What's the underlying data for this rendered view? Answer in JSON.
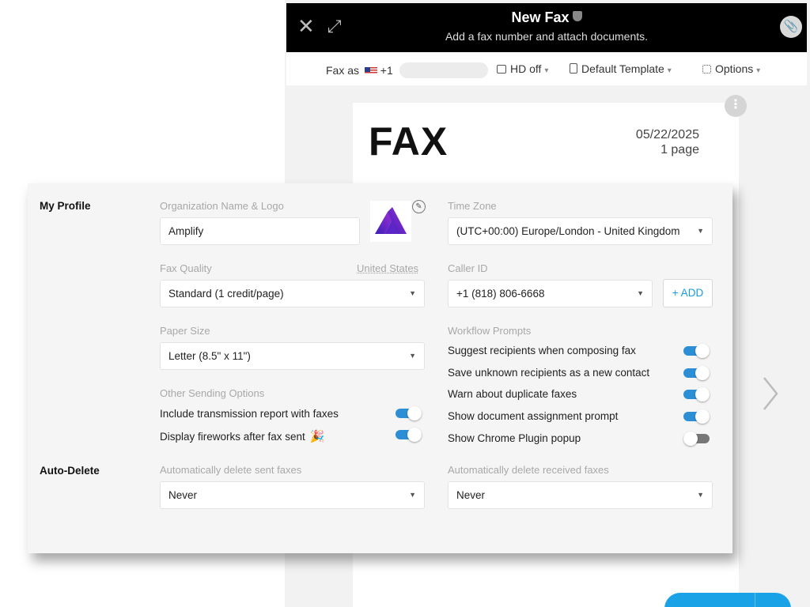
{
  "composer": {
    "title": "New Fax",
    "subtitle": "Add a fax number and attach documents.",
    "close_glyph": "✕",
    "expand_glyph": "⤡",
    "attach_glyph": "📎",
    "toolbar": {
      "fax_as_label": "Fax as",
      "country_code": "+1",
      "hd_label": "HD off",
      "template_label": "Default Template",
      "options_label": "Options",
      "caret": "▾"
    },
    "paper": {
      "heading": "FAX",
      "date": "05/22/2025",
      "pages": "1 page"
    },
    "kebab_glyph": "⋮"
  },
  "settings": {
    "my_profile": {
      "section_label": "My Profile",
      "org_label": "Organization Name & Logo",
      "org_value": "Amplify",
      "edit_glyph": "✎",
      "time_zone_label": "Time Zone",
      "time_zone_value": "(UTC+00:00) Europe/London - United Kingdom",
      "fax_quality_label": "Fax Quality",
      "fax_quality_region": "United States",
      "fax_quality_value": "Standard (1 credit/page)",
      "caller_id_label": "Caller ID",
      "caller_id_value": "+1 (818) 806-6668",
      "add_label": "+ ADD",
      "paper_size_label": "Paper Size",
      "paper_size_value": "Letter (8.5\" x 11\")",
      "workflow_label": "Workflow Prompts",
      "workflow_prompts": [
        {
          "label": "Suggest recipients when composing fax",
          "on": true
        },
        {
          "label": "Save unknown recipients as a new contact",
          "on": true
        },
        {
          "label": "Warn about duplicate faxes",
          "on": true
        },
        {
          "label": "Show document assignment prompt",
          "on": true
        },
        {
          "label": "Show Chrome Plugin popup",
          "on": false
        }
      ],
      "other_label": "Other Sending Options",
      "other_options": [
        {
          "label": "Include transmission report with faxes",
          "on": true
        },
        {
          "label": "Display fireworks after fax sent",
          "on": true,
          "icon": "🎉"
        }
      ]
    },
    "auto_delete": {
      "section_label": "Auto-Delete",
      "sent_label": "Automatically delete sent faxes",
      "sent_value": "Never",
      "received_label": "Automatically delete received faxes",
      "received_value": "Never"
    },
    "dropdown_glyph": "▼",
    "accent_color": "#2c8fd6",
    "logo_colors": [
      "#3b1fb8",
      "#8b2fd0"
    ]
  }
}
